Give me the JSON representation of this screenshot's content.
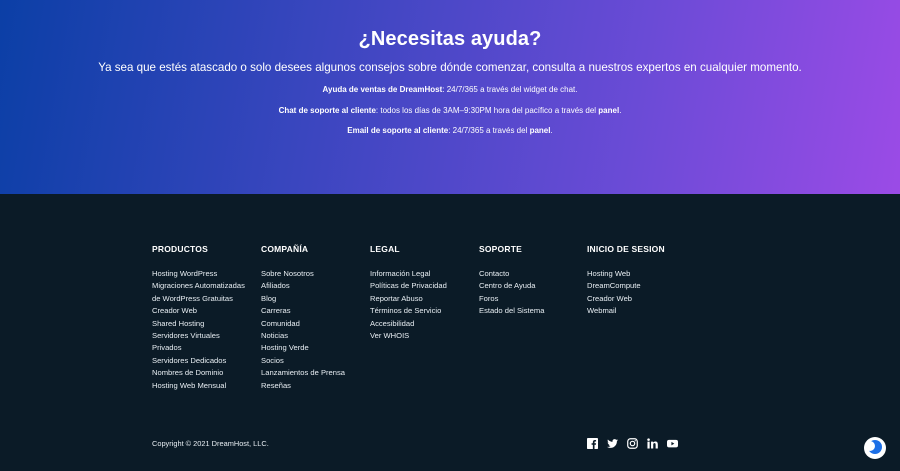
{
  "help": {
    "title": "¿Necesitas ayuda?",
    "subtitle": "Ya sea que estés atascado o solo desees algunos consejos sobre dónde comenzar, consulta a nuestros expertos en cualquier momento.",
    "sales_label": "Ayuda de ventas de DreamHost",
    "sales_text": ": 24/7/365 a través del widget de chat.",
    "support_label": "Chat de soporte al cliente",
    "support_text": ": todos los días de 3AM–9:30PM hora del pacífico a través del ",
    "support_link": "panel",
    "support_end": ".",
    "email_label": "Email de soporte al cliente",
    "email_text": ": 24/7/365 a través del ",
    "email_link": "panel",
    "email_end": "."
  },
  "footer": {
    "columns": [
      {
        "title": "PRODUCTOS",
        "items": [
          "Hosting WordPress",
          "Migraciones Automatizadas",
          "de WordPress Gratuitas",
          "Creador Web",
          "Shared Hosting",
          "Servidores Virtuales",
          "Privados",
          "Servidores Dedicados",
          "Nombres de Dominio",
          "Hosting Web Mensual"
        ]
      },
      {
        "title": "COMPAÑÍA",
        "items": [
          "Sobre Nosotros",
          "Afiliados",
          "Blog",
          "Carreras",
          "Comunidad",
          "Noticias",
          "Hosting Verde",
          "Socios",
          "Lanzamientos de Prensa",
          "Reseñas"
        ]
      },
      {
        "title": "LEGAL",
        "items": [
          "Información Legal",
          "Políticas de Privacidad",
          "Reportar Abuso",
          "Términos de Servicio",
          "Accesibilidad",
          "Ver WHOIS"
        ]
      },
      {
        "title": "SOPORTE",
        "items": [
          "Contacto",
          "Centro de Ayuda",
          "Foros",
          "Estado del Sistema"
        ]
      },
      {
        "title": "INICIO DE SESION",
        "items": [
          "Hosting Web",
          "DreamCompute",
          "Creador Web",
          "Webmail"
        ]
      }
    ],
    "copyright": "Copyright © 2021 DreamHost, LLC.",
    "social_icons": [
      "facebook-icon",
      "twitter-icon",
      "instagram-icon",
      "linkedin-icon",
      "youtube-icon"
    ]
  },
  "colors": {
    "footer_bg": "#0b1b27",
    "gradient_start": "#0b3fa6",
    "gradient_end": "#9b4be6",
    "chat_accent": "#1c6fe6"
  }
}
